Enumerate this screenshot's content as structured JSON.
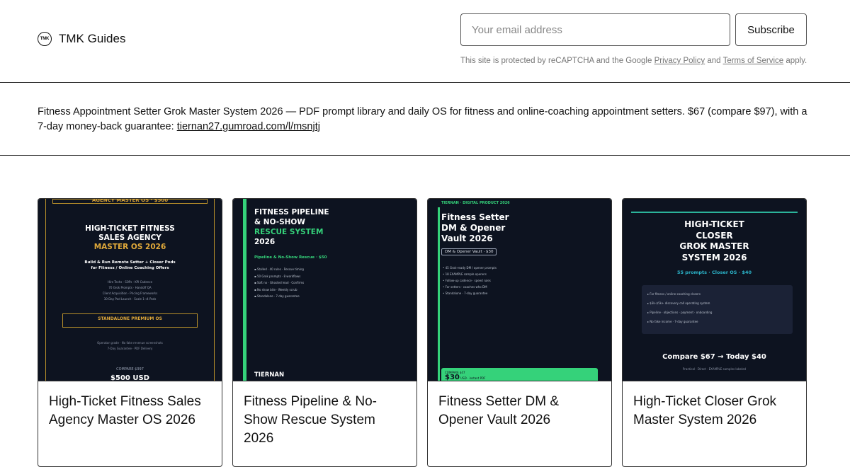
{
  "header": {
    "brand_logo_text": "TMK",
    "brand_name": "TMK Guides",
    "email_placeholder": "Your email address",
    "subscribe_label": "Subscribe",
    "legal_prefix": "This site is protected by reCAPTCHA and the Google",
    "privacy_link": "Privacy Policy",
    "legal_and": "and",
    "terms_link": "Terms of Service",
    "legal_suffix": "apply."
  },
  "announcement": {
    "text": "Fitness Appointment Setter Grok Master System 2026 — PDF prompt library and daily OS for fitness and online-coaching appointment setters. $67 (compare $97), with a 7-day money-back guarantee:",
    "link": "tiernan27.gumroad.com/l/msnjtj"
  },
  "products": [
    {
      "title": "High-Ticket Fitness Sales Agency Master OS 2026",
      "cover": {
        "top_label": "AGENCY MASTER OS · $500",
        "title_lines": [
          "HIGH-TICKET FITNESS",
          "SALES AGENCY"
        ],
        "title_gold": "MASTER OS 2026",
        "subtitle_lines": [
          "Build & Run Remote Setter + Closer Pods",
          "for Fitness / Online Coaching Offers"
        ],
        "small_lines": [
          "Hire Techs · SOPs · KPI Cadence",
          "70 Grok Prompts · Handoff QA",
          "Client Acquisition · Pricing Frameworks",
          "30-Day Pod Launch · Scale 1→4 Pods"
        ],
        "box_label": "STANDALONE PREMIUM OS",
        "bottom_lines": [
          "Operator grade · No fake revenue screenshots",
          "7-Day Guarantee · PDF Delivery"
        ],
        "compare": "COMPARE $997",
        "price": "$500 USD"
      }
    },
    {
      "title": "Fitness Pipeline & No-Show Rescue System 2026",
      "cover": {
        "title_lines": [
          "FITNESS PIPELINE",
          "& NO-SHOW"
        ],
        "title_green": "RESCUE SYSTEM",
        "year": "2026",
        "meta": "Pipeline & No-Show Rescue · $50",
        "list": [
          "▪ Stalled · 40 rules · Rescue timing",
          "▪ 50 Grok prompts · 8 workflows",
          "▪ Soft no · Ghosted lead · Confirms",
          "▪ No show bite · Weekly scrub",
          "▪ Standalone · 7-day guarantee"
        ],
        "footer": "TIERNAN"
      }
    },
    {
      "title": "Fitness Setter DM & Opener Vault 2026",
      "cover": {
        "top_label": "TIERNAN · DIGITAL PRODUCT 2026",
        "title_lines": [
          "Fitness Setter",
          "DM & Opener",
          "Vault 2026"
        ],
        "badge": "DM & Opener Vault · $30",
        "list": [
          "• 45 Grok-ready DM / opener prompts",
          "• 18 EXAMPLE sample openers",
          "• Follow-up cadence · speed rules",
          "• For setters · coaches who DM",
          "• Standalone · 7-day guarantee"
        ],
        "compare": "COMPARE $47",
        "price": "$30",
        "price_note": "USD · instant PDF"
      }
    },
    {
      "title": "High-Ticket Closer Grok Master System 2026",
      "cover": {
        "title_lines": [
          "HIGH-TICKET",
          "CLOSER",
          "GROK MASTER",
          "SYSTEM 2026"
        ],
        "meta": "55 prompts · Closer OS · $40",
        "box_lines": [
          "▸ For fitness / online-coaching closers",
          "▸ $3k–$5k+ discovery call operating system",
          "▸ Pipeline · objections · payment · onboarding",
          "▸ No fake income · 7-day guarantee"
        ],
        "compare": "Compare $67  →  Today $40",
        "tagline": "Practical · Direct · EXAMPLE samples labeled"
      }
    }
  ]
}
